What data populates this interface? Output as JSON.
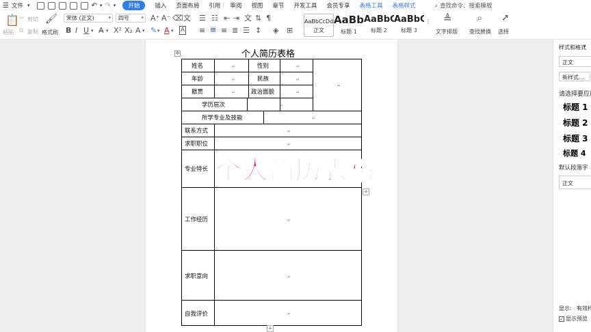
{
  "menubar": {
    "file": "文件",
    "tabs": [
      "开始",
      "插入",
      "页面布局",
      "引用",
      "审阅",
      "视图",
      "章节",
      "开发工具",
      "会员专享",
      "表格工具",
      "表格样式"
    ],
    "active_tab": "开始",
    "search": "查找命令、搜索模板"
  },
  "ribbon": {
    "paste": "粘贴",
    "cut": "剪切",
    "copy": "复制",
    "format_painter": "格式刷",
    "font_name": "宋体 (正文)",
    "font_size": "四号",
    "styles": [
      {
        "sample": "AaBbCcDd",
        "caption": "正文"
      },
      {
        "sample": "AaBb",
        "caption": "标题 1"
      },
      {
        "sample": "AaBbC",
        "caption": "标题 2"
      },
      {
        "sample": "AaBbC",
        "caption": "标题 3"
      }
    ],
    "text_layout": "文字排版",
    "find_replace": "查找替换",
    "select": "选择"
  },
  "document": {
    "title": "个人简历表格",
    "labels": {
      "name": "姓名",
      "gender": "性别",
      "age": "年龄",
      "ethnicity": "民族",
      "origin": "籍贯",
      "political": "政治面貌",
      "education": "学历层次",
      "major": "所学专业及技能",
      "contact": "联系方式",
      "position": "求职职位",
      "specialty": "专业特长",
      "experience": "工作经历",
      "intention": "求职意向",
      "self_eval": "自我评价"
    }
  },
  "overlay_text": "个人简历表格",
  "side_panel": {
    "title": "样式和格式",
    "current_style": "正文",
    "new_style": "新样式...",
    "prompt": "请选择要应用",
    "headings": [
      "标题 1",
      "标题 2",
      "标题 3",
      "标题 4"
    ],
    "default_font": "默认段落字",
    "style_box": "正文",
    "show_label": "显示:",
    "show_value": "有效样",
    "preview": "显示预览"
  }
}
